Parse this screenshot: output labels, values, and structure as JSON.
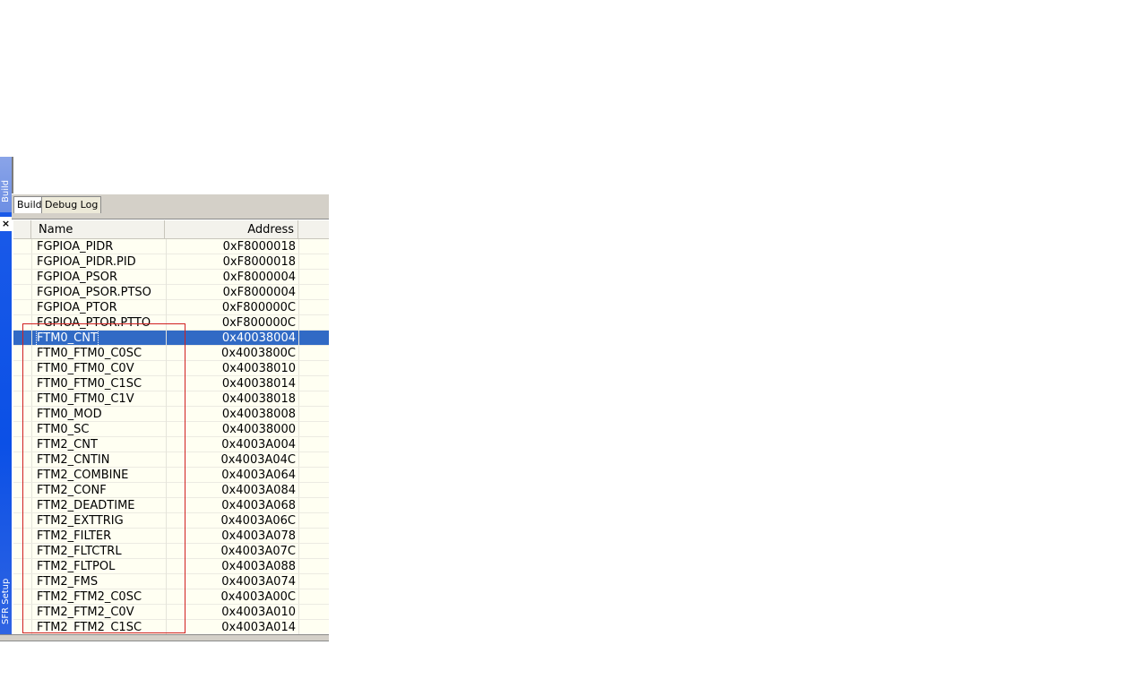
{
  "vertical_tabs": {
    "build": "Build",
    "sfr_setup": "SFR Setup"
  },
  "close_glyph": "×",
  "tabs": [
    {
      "label": "Build"
    },
    {
      "label": "Debug Log"
    }
  ],
  "table": {
    "headers": {
      "name": "Name",
      "address": "Address"
    },
    "rows": [
      {
        "name": "FGPIOA_PIDR",
        "address": "0xF8000018"
      },
      {
        "name": "FGPIOA_PIDR.PID",
        "address": "0xF8000018"
      },
      {
        "name": "FGPIOA_PSOR",
        "address": "0xF8000004"
      },
      {
        "name": "FGPIOA_PSOR.PTSO",
        "address": "0xF8000004"
      },
      {
        "name": "FGPIOA_PTOR",
        "address": "0xF800000C"
      },
      {
        "name": "FGPIOA_PTOR.PTTO",
        "address": "0xF800000C"
      },
      {
        "name": "FTM0_CNT",
        "address": "0x40038004",
        "selected": true
      },
      {
        "name": "FTM0_FTM0_C0SC",
        "address": "0x4003800C"
      },
      {
        "name": "FTM0_FTM0_C0V",
        "address": "0x40038010"
      },
      {
        "name": "FTM0_FTM0_C1SC",
        "address": "0x40038014"
      },
      {
        "name": "FTM0_FTM0_C1V",
        "address": "0x40038018"
      },
      {
        "name": "FTM0_MOD",
        "address": "0x40038008"
      },
      {
        "name": "FTM0_SC",
        "address": "0x40038000"
      },
      {
        "name": "FTM2_CNT",
        "address": "0x4003A004"
      },
      {
        "name": "FTM2_CNTIN",
        "address": "0x4003A04C"
      },
      {
        "name": "FTM2_COMBINE",
        "address": "0x4003A064"
      },
      {
        "name": "FTM2_CONF",
        "address": "0x4003A084"
      },
      {
        "name": "FTM2_DEADTIME",
        "address": "0x4003A068"
      },
      {
        "name": "FTM2_EXTTRIG",
        "address": "0x4003A06C"
      },
      {
        "name": "FTM2_FILTER",
        "address": "0x4003A078"
      },
      {
        "name": "FTM2_FLTCTRL",
        "address": "0x4003A07C"
      },
      {
        "name": "FTM2_FLTPOL",
        "address": "0x4003A088"
      },
      {
        "name": "FTM2_FMS",
        "address": "0x4003A074"
      },
      {
        "name": "FTM2_FTM2_C0SC",
        "address": "0x4003A00C"
      },
      {
        "name": "FTM2_FTM2_C0V",
        "address": "0x4003A010"
      },
      {
        "name": "FTM2_FTM2_C1SC",
        "address": "0x4003A014"
      }
    ]
  },
  "colors": {
    "selection": "#316ac5",
    "highlight_box": "#d02020",
    "sidebar": "#0b50e6"
  }
}
